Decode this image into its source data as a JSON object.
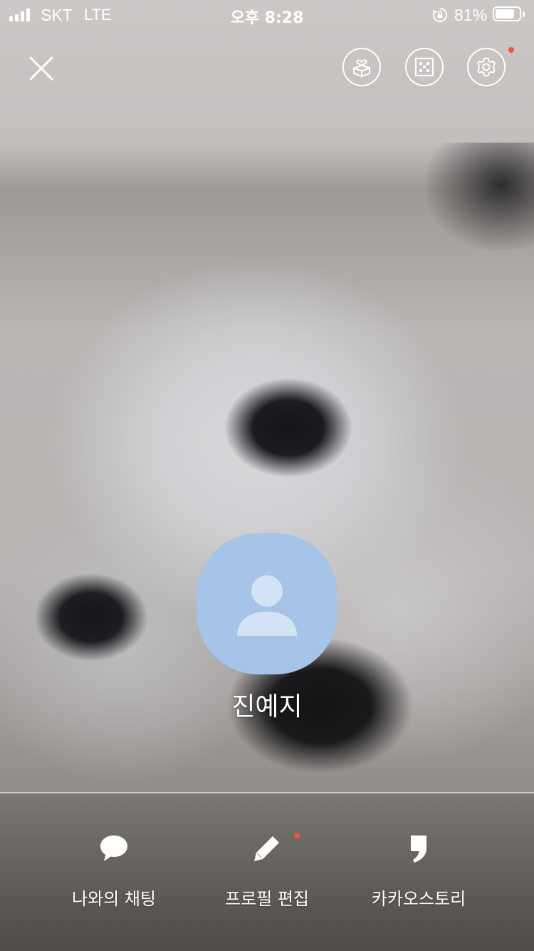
{
  "status_bar": {
    "carrier": "SKT",
    "network": "LTE",
    "time": "오후 8:28",
    "battery_percent": "81%",
    "battery_level": 0.81,
    "icons": [
      "signal-icon",
      "orientation-lock-icon",
      "battery-icon"
    ]
  },
  "top_bar": {
    "icons": [
      "close-icon",
      "gift-box-icon",
      "qr-code-icon",
      "settings-icon"
    ],
    "settings_has_notification": true
  },
  "profile": {
    "name": "진예지",
    "avatar_color": "#a6c3e8",
    "avatar_icon": "default-person-icon"
  },
  "actions": [
    {
      "label": "나와의 채팅",
      "icon": "chat-bubble-icon"
    },
    {
      "label": "프로필 편집",
      "icon": "pencil-icon",
      "has_notification": true
    },
    {
      "label": "카카오스토리",
      "icon": "kakaostory-icon"
    }
  ],
  "colors": {
    "notification_dot": "#f2543a",
    "avatar": "#a6c3e8"
  }
}
